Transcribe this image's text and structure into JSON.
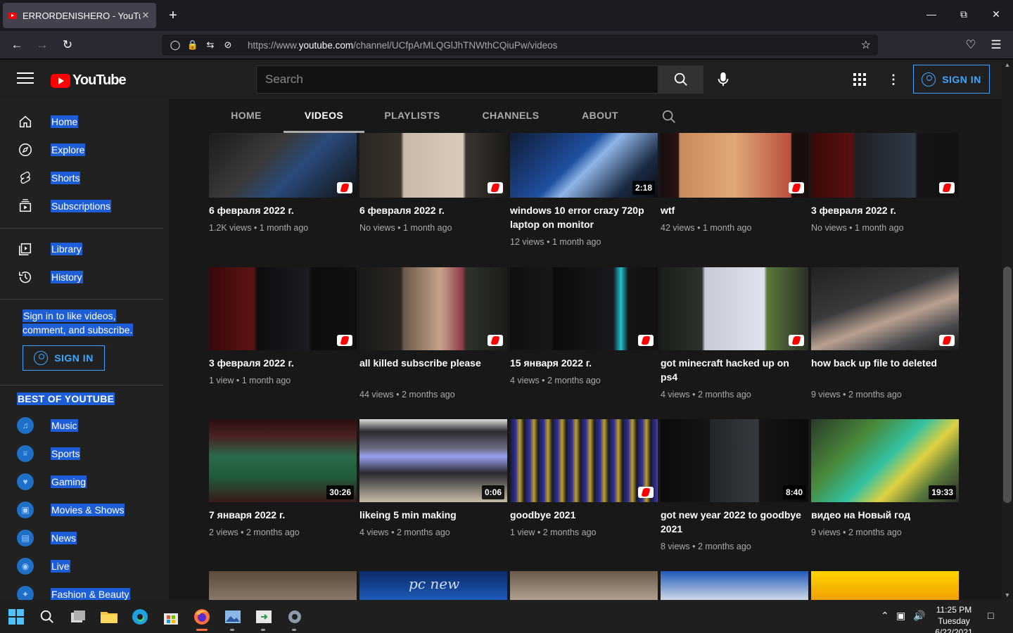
{
  "browser": {
    "tab_title": "ERRORDENISHERO - YouTube",
    "tab_close": "✕",
    "new_tab": "+",
    "url_prefix": "https://www.",
    "url_domain": "youtube.com",
    "url_path": "/channel/UCfpArMLQGlJhTNWthCQiuPw/videos"
  },
  "header": {
    "logo_text": "YouTube",
    "search_placeholder": "Search",
    "sign_in": "SIGN IN"
  },
  "sidebar": {
    "main": [
      {
        "label": "Home",
        "icon": "home-icon"
      },
      {
        "label": "Explore",
        "icon": "compass-icon"
      },
      {
        "label": "Shorts",
        "icon": "shorts-icon"
      },
      {
        "label": "Subscriptions",
        "icon": "subscriptions-icon"
      }
    ],
    "library": [
      {
        "label": "Library",
        "icon": "library-icon"
      },
      {
        "label": "History",
        "icon": "history-icon"
      }
    ],
    "signin_message": "Sign in to like videos, comment, and subscribe.",
    "signin_button": "SIGN IN",
    "best_heading": "BEST OF YOUTUBE",
    "best": [
      {
        "label": "Music",
        "icon": "music-icon",
        "glyph": "♫"
      },
      {
        "label": "Sports",
        "icon": "trophy-icon",
        "glyph": "🏆"
      },
      {
        "label": "Gaming",
        "icon": "gaming-icon",
        "glyph": "♥"
      },
      {
        "label": "Movies & Shows",
        "icon": "movies-icon",
        "glyph": "▣"
      },
      {
        "label": "News",
        "icon": "news-icon",
        "glyph": "▤"
      },
      {
        "label": "Live",
        "icon": "live-icon",
        "glyph": "◉"
      },
      {
        "label": "Fashion & Beauty",
        "icon": "fashion-icon",
        "glyph": "✦"
      }
    ]
  },
  "channel_tabs": [
    "HOME",
    "VIDEOS",
    "PLAYLISTS",
    "CHANNELS",
    "ABOUT"
  ],
  "active_tab": "VIDEOS",
  "videos": [
    {
      "title": "6 февраля 2022 г.",
      "meta": "1.2K views • 1 month ago",
      "duration": "",
      "short": true,
      "bg": "linear-gradient(135deg,#1a1a1a,#3a3a3a 40%,#2a4a7a 60%,#111)"
    },
    {
      "title": "6 февраля 2022 г.",
      "meta": "No views • 1 month ago",
      "duration": "",
      "short": true,
      "bg": "linear-gradient(90deg,#2a2622 0%,#3b332c 28%,#c8b9a8 30%,#d9cbb9 70%,#3a3530 72%,#1c1a18 100%)"
    },
    {
      "title": "windows 10 error crazy 720p laptop on monitor",
      "meta": "12 views • 1 month ago",
      "duration": "2:18",
      "short": false,
      "bg": "linear-gradient(135deg,#0f1a2c,#1f4fa0 45%,#8fb4e6 55%,#1a2a44 80%,#0c0c10)"
    },
    {
      "title": "wtf",
      "meta": "42 views • 1 month ago",
      "duration": "",
      "short": true,
      "bg": "linear-gradient(90deg,#1a0d0d 0%,#2a1414 12%,#c98a5a 13%,#e0a878 50%,#b9503f 88%,#1a0d0d 89%)"
    },
    {
      "title": "3 февраля 2022 г.",
      "meta": "No views • 1 month ago",
      "duration": "",
      "short": true,
      "bg": "linear-gradient(90deg,#3a0a0a 0%,#5a1010 28%,#1f1f24 30%,#2e3a48 70%,#151518 72%,#111 100%)"
    },
    {
      "title": "3 февраля 2022 г.",
      "meta": "1 view • 1 month ago",
      "duration": "",
      "short": true,
      "bg": "linear-gradient(90deg,#3a0808 0%,#5c1414 30%,#0d0d10 33%,#1c1c22 67%,#0d0d10 70%,#101010 100%)"
    },
    {
      "title": "all killed subscribe please",
      "meta": "44 views • 2 months ago",
      "duration": "",
      "short": true,
      "bg": "linear-gradient(90deg,#1c1a18 0%,#2a2724 28%,#6b5a4a 30%,#c7a38a 55%,#8a3a4a 70%,#2e332c 72%,#1a1c18 100%)"
    },
    {
      "title": "15 января 2022 г.",
      "meta": "4 views • 2 months ago",
      "duration": "",
      "short": true,
      "bg": "linear-gradient(90deg,#0f0f0f 0%,#181818 28%,#0b0b0d 30%,#1a1a1e 70%,#20c0d0 75%,#141414 80%,#111 100%)"
    },
    {
      "title": "got minecraft hacked up on ps4",
      "meta": "4 views • 2 months ago",
      "duration": "",
      "short": true,
      "bg": "linear-gradient(90deg,#1a1e1a 0%,#2c332a 28%,#c7c9d6 30%,#e0e2ee 70%,#5a7a3a 72%,#2a2f26 100%)"
    },
    {
      "title": "how back up file to deleted",
      "meta": "9 views • 2 months ago",
      "duration": "",
      "short": true,
      "bg": "linear-gradient(160deg,#222 0%,#3a3a3c 40%,#b8a090 60%,#4a4a4e 80%,#1a1a1a)"
    },
    {
      "title": "7 января 2022 г.",
      "meta": "2 views • 2 months ago",
      "duration": "30:26",
      "short": false,
      "bg": "linear-gradient(180deg,#2a1010 0%,#4a2020 20%,#2a6a4a 45%,#1f5a3a 70%,#3a1a1a 100%)"
    },
    {
      "title": "likeing 5 min making",
      "meta": "4 views • 2 months ago",
      "duration": "0:06",
      "short": false,
      "bg": "linear-gradient(180deg,#dcdcdc 0%,#2a2a30 15%,#6a6a80 35%,#9aa0f0 45%,#2a2a30 65%,#c8bca8 100%)"
    },
    {
      "title": "goodbye 2021",
      "meta": "1 view • 2 months ago",
      "duration": "",
      "short": true,
      "bg": "repeating-linear-gradient(90deg,#1a1a2a 0px,#3030a0 8px,#c0a020 14px,#1a1a2a 20px)"
    },
    {
      "title": "got new year 2022 to goodbye 2021",
      "meta": "8 views • 2 months ago",
      "duration": "8:40",
      "short": false,
      "bg": "linear-gradient(90deg,#0c0c0c 0%,#141414 33%,#23272a 34%,#36393f 66%,#141414 67%,#0c0c0c 100%)"
    },
    {
      "title": "видео на Новый год",
      "meta": "9 views • 2 months ago",
      "duration": "19:33",
      "short": false,
      "bg": "linear-gradient(135deg,#2a3a2a 0%,#4a8a3a 30%,#30c0a0 50%,#e0d040 65%,#5a7a3a 80%,#2a2a2a)"
    },
    {
      "title": "",
      "meta": "",
      "duration": "",
      "short": false,
      "bg": "linear-gradient(180deg,#5a4a3a,#8a7a6a)"
    },
    {
      "title": "",
      "meta": "",
      "duration": "",
      "short": false,
      "bg": "linear-gradient(180deg,#0a2a6a,#1e5ab8)",
      "overlay": "pc new"
    },
    {
      "title": "",
      "meta": "",
      "duration": "",
      "short": false,
      "bg": "linear-gradient(180deg,#6a5a4a,#b0a090)"
    },
    {
      "title": "",
      "meta": "",
      "duration": "",
      "short": false,
      "bg": "linear-gradient(180deg,#1e5ab8,#d0d8e8)"
    },
    {
      "title": "",
      "meta": "",
      "duration": "",
      "short": false,
      "bg": "linear-gradient(180deg,#ffd400,#f0a000)"
    }
  ],
  "taskbar": {
    "time": "11:25 PM",
    "day": "Tuesday",
    "date": "6/22/2021"
  },
  "colors": {
    "accent_blue": "#3ea6ff",
    "youtube_red": "#ff0000",
    "selection": "#1d5dd6"
  }
}
